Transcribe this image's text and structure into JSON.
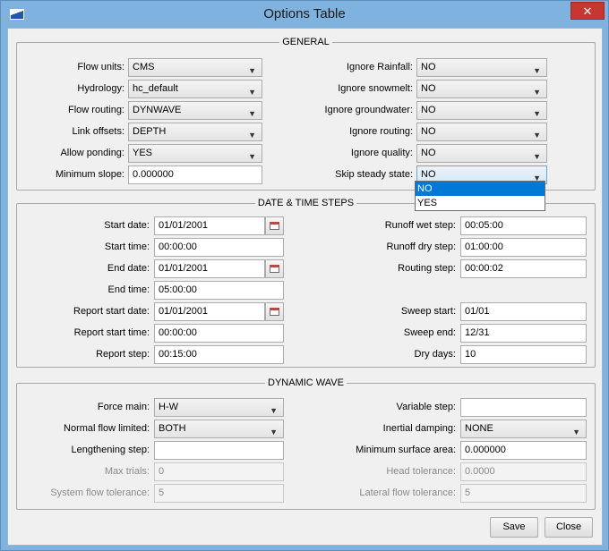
{
  "window": {
    "title": "Options Table",
    "close_glyph": "✕"
  },
  "general": {
    "title": "GENERAL",
    "flow_units": {
      "label": "Flow units:",
      "value": "CMS"
    },
    "hydrology": {
      "label": "Hydrology:",
      "value": "hc_default"
    },
    "flow_routing": {
      "label": "Flow routing:",
      "value": "DYNWAVE"
    },
    "link_offsets": {
      "label": "Link offsets:",
      "value": "DEPTH"
    },
    "allow_ponding": {
      "label": "Allow ponding:",
      "value": "YES"
    },
    "minimum_slope": {
      "label": "Minimum slope:",
      "value": "0.000000"
    },
    "ignore_rainfall": {
      "label": "Ignore Rainfall:",
      "value": "NO"
    },
    "ignore_snowmelt": {
      "label": "Ignore snowmelt:",
      "value": "NO"
    },
    "ignore_groundwater": {
      "label": "Ignore groundwater:",
      "value": "NO"
    },
    "ignore_routing": {
      "label": "Ignore routing:",
      "value": "NO"
    },
    "ignore_quality": {
      "label": "Ignore quality:",
      "value": "NO"
    },
    "skip_steady_state": {
      "label": "Skip steady state:",
      "value": "NO",
      "options": [
        "NO",
        "YES"
      ]
    }
  },
  "datetime": {
    "title": "DATE & TIME STEPS",
    "start_date": {
      "label": "Start date:",
      "value": "01/01/2001"
    },
    "start_time": {
      "label": "Start time:",
      "value": "00:00:00"
    },
    "end_date": {
      "label": "End date:",
      "value": "01/01/2001"
    },
    "end_time": {
      "label": "End time:",
      "value": "05:00:00"
    },
    "report_start_date": {
      "label": "Report start date:",
      "value": "01/01/2001"
    },
    "report_start_time": {
      "label": "Report start time:",
      "value": "00:00:00"
    },
    "report_step": {
      "label": "Report step:",
      "value": "00:15:00"
    },
    "runoff_wet_step": {
      "label": "Runoff wet step:",
      "value": "00:05:00"
    },
    "runoff_dry_step": {
      "label": "Runoff dry step:",
      "value": "01:00:00"
    },
    "routing_step": {
      "label": "Routing step:",
      "value": "00:00:02"
    },
    "sweep_start": {
      "label": "Sweep start:",
      "value": "01/01"
    },
    "sweep_end": {
      "label": "Sweep end:",
      "value": "12/31"
    },
    "dry_days": {
      "label": "Dry days:",
      "value": "10"
    }
  },
  "dynamic_wave": {
    "title": "DYNAMIC WAVE",
    "force_main": {
      "label": "Force main:",
      "value": "H-W"
    },
    "normal_flow_limited": {
      "label": "Normal flow limited:",
      "value": "BOTH"
    },
    "lengthening_step": {
      "label": "Lengthening step:",
      "value": ""
    },
    "max_trials": {
      "label": "Max trials:",
      "value": "0"
    },
    "system_flow_tolerance": {
      "label": "System flow tolerance:",
      "value": "5"
    },
    "variable_step": {
      "label": "Variable step:",
      "value": ""
    },
    "inertial_damping": {
      "label": "Inertial damping:",
      "value": "NONE"
    },
    "minimum_surface_area": {
      "label": "Minimum surface area:",
      "value": "0.000000"
    },
    "head_tolerance": {
      "label": "Head tolerance:",
      "value": "0.0000"
    },
    "lateral_flow_tolerance": {
      "label": "Lateral flow tolerance:",
      "value": "5"
    }
  },
  "buttons": {
    "save": "Save",
    "close": "Close"
  },
  "icons": {
    "window": "app-icon",
    "combo_arrow": "chevron-down-icon",
    "date_picker": "calendar-icon"
  }
}
